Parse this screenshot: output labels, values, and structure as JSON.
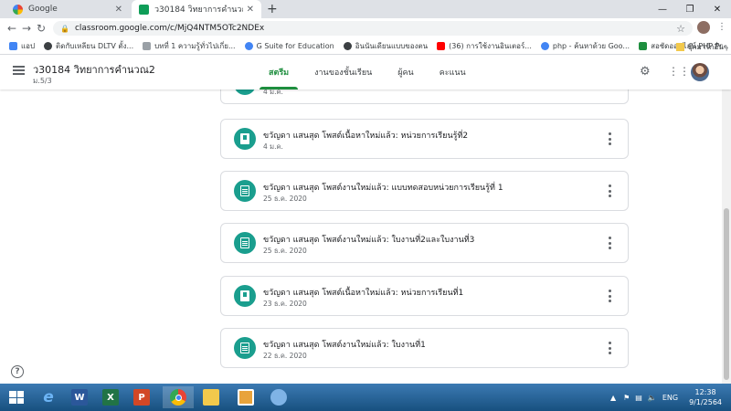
{
  "browser": {
    "tabs": [
      {
        "title": "Google",
        "icon": "google-icon",
        "active": false
      },
      {
        "title": "ว30184 วิทยาการคำนวณ2 ม.5/3",
        "icon": "classroom-icon",
        "active": true
      }
    ],
    "url": "classroom.google.com/c/MjQ4NTM5OTc2NDEx",
    "bookmarks": [
      {
        "label": "แอป",
        "color": "#4285f4"
      },
      {
        "label": "ติดกับเหลียน DLTV ตั้ง...",
        "color": "#3c4043"
      },
      {
        "label": "บทที่ 1 ความรู้ทั่วไปเกี่ย...",
        "color": "#5f6368"
      },
      {
        "label": "G Suite for Education",
        "color": "#4285f4"
      },
      {
        "label": "อินนันเดียนแบบของตน",
        "color": "#3c4043"
      },
      {
        "label": "(36) การใช้งานอินเตอร์...",
        "color": "#ff0000"
      },
      {
        "label": "php - ค้นหาด้วย Goo...",
        "color": "#4285f4"
      },
      {
        "label": "สอชัดออนไลน์ PHP Pr...",
        "color": "#1e8e3e"
      }
    ],
    "bookmarks_other": "บุ๊กมาร์กอื่นๆ"
  },
  "classroom": {
    "class_title": "ว30184 วิทยาการคำนวณ2",
    "section": "ม.5/3",
    "nav": [
      {
        "label": "สตรีม",
        "active": true
      },
      {
        "label": "งานของชั้นเรียน",
        "active": false
      },
      {
        "label": "ผู้คน",
        "active": false
      },
      {
        "label": "คะแนน",
        "active": false
      }
    ],
    "partial_card_date": "4 ม.ค.",
    "posts": [
      {
        "title": "ขวัญดา แสนสุด โพสต์เนื้อหาใหม่แล้ว: หน่วยการเรียนรู้ที่2",
        "date": "4 ม.ค.",
        "icon": "book-icon"
      },
      {
        "title": "ขวัญดา แสนสุด โพสต์งานใหม่แล้ว: แบบทดสอบหน่วยการเรียนรู้ที่ 1",
        "date": "25 ธ.ค. 2020",
        "icon": "assignment-icon"
      },
      {
        "title": "ขวัญดา แสนสุด โพสต์งานใหม่แล้ว: ใบงานที่2และใบงานที่3",
        "date": "25 ธ.ค. 2020",
        "icon": "assignment-icon"
      },
      {
        "title": "ขวัญดา แสนสุด โพสต์เนื้อหาใหม่แล้ว: หน่วยการเรียนที่1",
        "date": "23 ธ.ค. 2020",
        "icon": "book-icon"
      },
      {
        "title": "ขวัญดา แสนสุด โพสต์งานใหม่แล้ว: ใบงานที่1",
        "date": "22 ธ.ค. 2020",
        "icon": "assignment-icon"
      }
    ],
    "colors": {
      "accent": "#1e8e3e",
      "icon_bg": "#1a9e8e"
    }
  },
  "taskbar": {
    "apps": [
      {
        "name": "internet-explorer-icon",
        "label": "e",
        "bg": "#1c6fc2"
      },
      {
        "name": "word-icon",
        "label": "W",
        "bg": "#2b579a"
      },
      {
        "name": "excel-icon",
        "label": "X",
        "bg": "#217346"
      },
      {
        "name": "powerpoint-icon",
        "label": "P",
        "bg": "#d24726"
      },
      {
        "name": "chrome-icon",
        "label": "",
        "bg": "#ffffff"
      },
      {
        "name": "file-explorer-icon",
        "label": "",
        "bg": "#f2c94c"
      },
      {
        "name": "photos-icon",
        "label": "",
        "bg": "#e8a33c"
      },
      {
        "name": "paint-icon",
        "label": "",
        "bg": "#7fb3e6"
      }
    ],
    "language": "ENG",
    "time": "12:38",
    "date": "9/1/2564"
  }
}
